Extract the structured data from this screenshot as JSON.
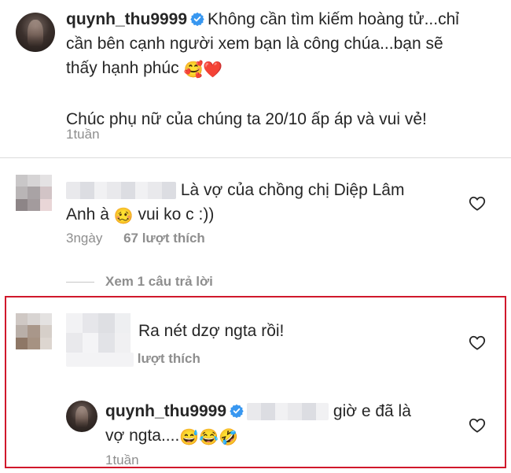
{
  "caption": {
    "username": "quynh_thu9999",
    "text_line1": "Không cần tìm kiếm hoàng tử...chỉ",
    "text_line2": "cần bên cạnh người xem bạn là công chúa...bạn sẽ",
    "text_line3": "thấy hạnh phúc",
    "emoji1": "🥰",
    "emoji2": "❤️",
    "text_line4": "Chúc phụ nữ của chúng ta 20/10 ấp áp và vui vẻ!",
    "time": "1tuần"
  },
  "comment1": {
    "text_line1": "Là vợ của chồng chị Diệp Lâm",
    "text_line2a": "Anh à",
    "emoji": "🥴",
    "text_line2b": "vui ko c :))",
    "time": "3ngày",
    "likes": "67 lượt thích"
  },
  "view_replies": "Xem 1 câu trả lời",
  "comment2": {
    "text": "Ra nét dzợ ngta rồi!",
    "likes_partial": "lượt thích"
  },
  "reply": {
    "username": "quynh_thu9999",
    "text_line1": "giờ e đã là",
    "text_line2": "vợ ngta....",
    "emojis": "😅😂🤣",
    "time": "1tuần"
  },
  "colors": {
    "highlight_border": "#d0182b",
    "verified_blue": "#3897f0",
    "meta_gray": "#8e8e8e"
  }
}
